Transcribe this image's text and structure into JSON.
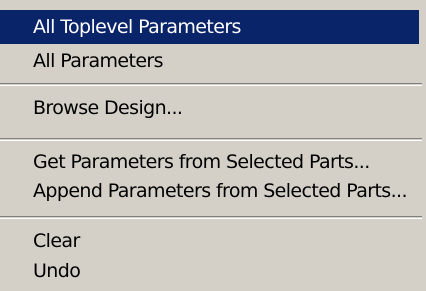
{
  "menu": {
    "items": [
      {
        "label": "All Toplevel Parameters",
        "selected": true
      },
      {
        "label": "All Parameters"
      },
      {
        "label": "Browse Design..."
      },
      {
        "label": "Get Parameters from Selected Parts..."
      },
      {
        "label": "Append Parameters from Selected Parts..."
      },
      {
        "label": "Clear"
      },
      {
        "label": "Undo"
      }
    ]
  },
  "colors": {
    "menu_background": "#d4d0c8",
    "selection_background": "#0a246a",
    "selection_text": "#ffffff",
    "separator_shadow": "#808080",
    "separator_highlight": "#ffffff"
  }
}
